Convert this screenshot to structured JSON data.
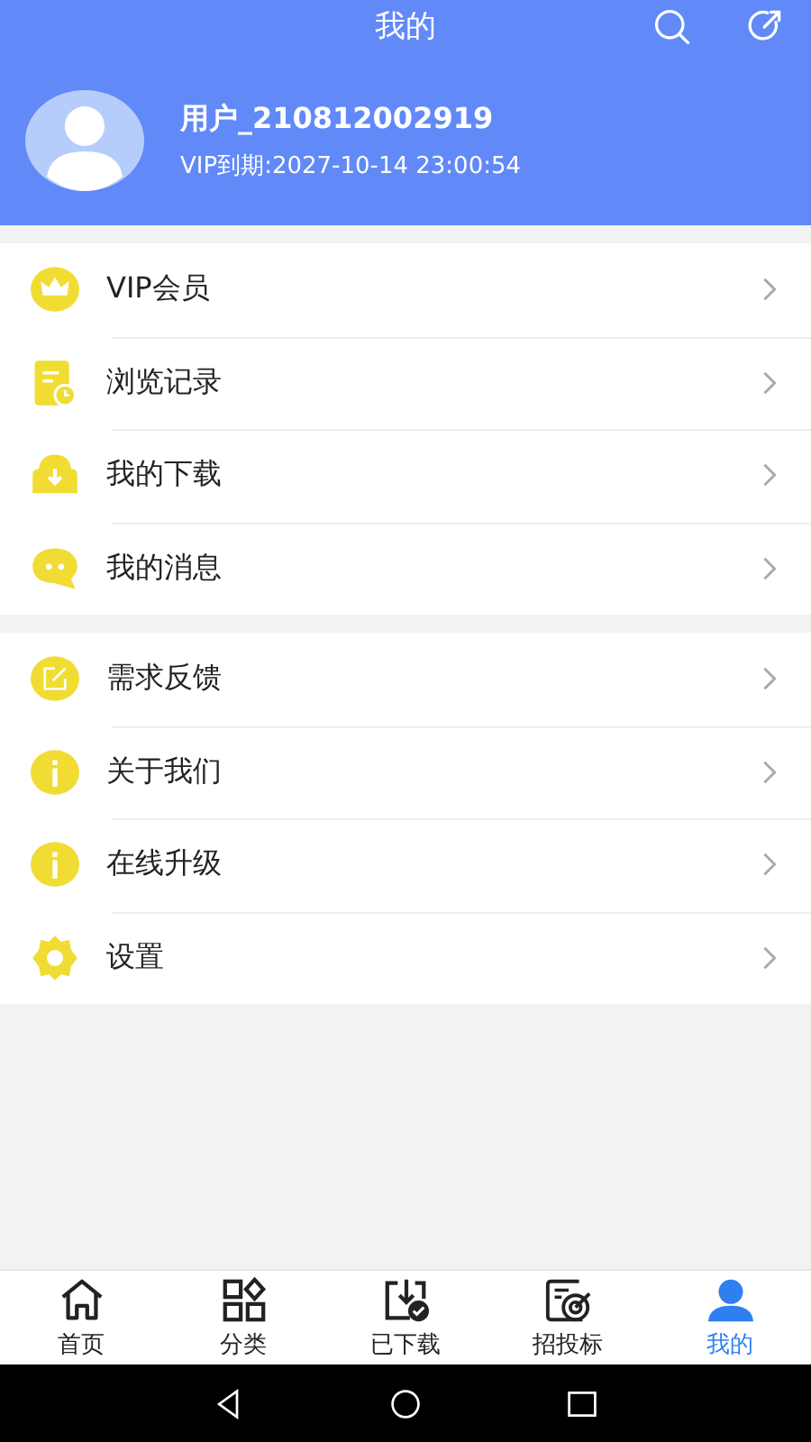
{
  "header": {
    "title": "我的"
  },
  "profile": {
    "username": "用户_210812002919",
    "vip_expiry": "VIP到期:2027-10-14 23:00:54"
  },
  "menu_groups": [
    {
      "items": [
        {
          "kind": "crown",
          "label": "VIP会员"
        },
        {
          "kind": "history",
          "label": "浏览记录"
        },
        {
          "kind": "download",
          "label": "我的下载"
        },
        {
          "kind": "message",
          "label": "我的消息"
        }
      ]
    },
    {
      "items": [
        {
          "kind": "feedback",
          "label": "需求反馈"
        },
        {
          "kind": "info",
          "label": "关于我们"
        },
        {
          "kind": "info",
          "label": "在线升级"
        },
        {
          "kind": "gear",
          "label": "设置"
        }
      ]
    }
  ],
  "tabs": [
    {
      "kind": "home",
      "label": "首页",
      "selected": false
    },
    {
      "kind": "grid",
      "label": "分类",
      "selected": false
    },
    {
      "kind": "downloaded",
      "label": "已下载",
      "selected": false
    },
    {
      "kind": "target",
      "label": "招投标",
      "selected": false
    },
    {
      "kind": "person",
      "label": "我的",
      "selected": true
    }
  ]
}
